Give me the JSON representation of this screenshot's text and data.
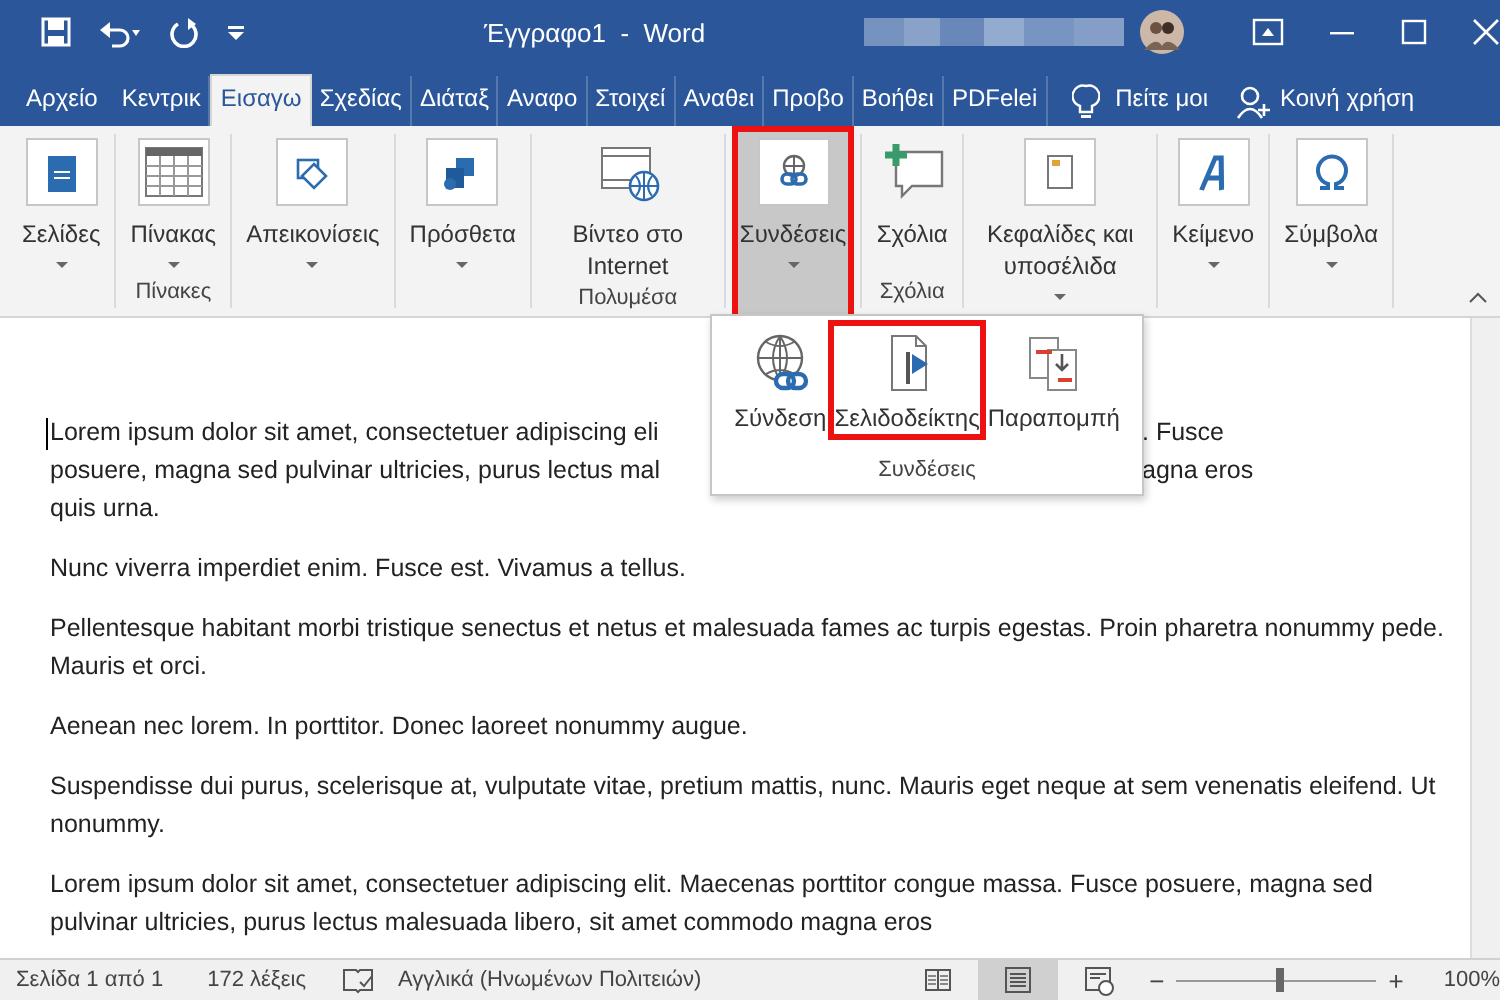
{
  "window": {
    "title": "Έγγραφο1  -  Word"
  },
  "tabs": [
    {
      "label": "Αρχείο",
      "selected": false
    },
    {
      "label": "Κεντρικ",
      "selected": false
    },
    {
      "label": "Εισαγω",
      "selected": true
    },
    {
      "label": "Σχεδίας",
      "selected": false
    },
    {
      "label": "Διάταξ",
      "selected": false
    },
    {
      "label": "Αναφο",
      "selected": false
    },
    {
      "label": "Στοιχεί",
      "selected": false
    },
    {
      "label": "Αναθει",
      "selected": false
    },
    {
      "label": "Προβο",
      "selected": false
    },
    {
      "label": "Βοήθει",
      "selected": false
    },
    {
      "label": "PDFelei",
      "selected": false
    }
  ],
  "tell_me": "Πείτε μοι",
  "share": "Κοινή χρήση",
  "ribbon": [
    {
      "buttons": [
        {
          "label": "Σελίδες",
          "kind": "page",
          "dropdown": true,
          "selected": false,
          "highlighted": false
        }
      ]
    },
    {
      "label": "Πίνακες",
      "buttons": [
        {
          "label": "Πίνακας",
          "kind": "table",
          "dropdown": true,
          "selected": false,
          "highlighted": false
        }
      ]
    },
    {
      "buttons": [
        {
          "label": "Απεικονίσεις",
          "kind": "shapes",
          "dropdown": true,
          "selected": false,
          "highlighted": false
        }
      ]
    },
    {
      "buttons": [
        {
          "label": "Πρόσθετα",
          "kind": "addin",
          "dropdown": true,
          "selected": false,
          "highlighted": false
        }
      ]
    },
    {
      "label": "Πολυμέσα",
      "buttons": [
        {
          "label": "Βίντεο στο Internet",
          "kind": "video",
          "dropdown": false,
          "selected": false,
          "highlighted": false
        }
      ]
    },
    {
      "buttons": [
        {
          "label": "Συνδέσεις",
          "kind": "link",
          "dropdown": true,
          "selected": true,
          "highlighted": true
        }
      ]
    },
    {
      "label": "Σχόλια",
      "buttons": [
        {
          "label": "Σχόλια",
          "kind": "comment",
          "dropdown": false,
          "selected": false,
          "highlighted": false
        }
      ]
    },
    {
      "buttons": [
        {
          "label": "Κεφαλίδες και υποσέλιδα",
          "kind": "header",
          "dropdown": true,
          "selected": false,
          "highlighted": false
        }
      ]
    },
    {
      "buttons": [
        {
          "label": "Κείμενο",
          "kind": "text",
          "dropdown": true,
          "selected": false,
          "highlighted": false
        }
      ]
    },
    {
      "buttons": [
        {
          "label": "Σύμβολα",
          "kind": "symbol",
          "dropdown": true,
          "selected": false,
          "highlighted": false
        }
      ]
    }
  ],
  "popup": {
    "label": "Συνδέσεις",
    "items": [
      {
        "label": "Σύνδεση",
        "kind": "globe",
        "highlighted": false
      },
      {
        "label": "Σελιδοδείκτης",
        "kind": "bookmark",
        "highlighted": true
      },
      {
        "label": "Παραπομπή",
        "kind": "crossref",
        "highlighted": false
      }
    ]
  },
  "document": {
    "paragraphs": [
      {
        "lines": [
          {
            "left": "Lorem ipsum dolor sit amet, consectetuer adipiscing eli",
            "right": ". Fusce"
          },
          {
            "left": "posuere, magna sed pulvinar ultricies, purus lectus mal",
            "right": "agna eros"
          },
          {
            "left": "quis urna."
          }
        ]
      },
      {
        "text": "Nunc viverra imperdiet enim. Fusce est. Vivamus a tellus."
      },
      {
        "text": "Pellentesque habitant morbi tristique senectus et netus et malesuada fames ac turpis egestas. Proin pharetra nonummy pede. Mauris et orci."
      },
      {
        "text": "Aenean nec lorem. In porttitor. Donec laoreet nonummy augue."
      },
      {
        "text": "Suspendisse dui purus, scelerisque at, vulputate vitae, pretium mattis, nunc. Mauris eget neque at sem venenatis eleifend. Ut nonummy."
      },
      {
        "text": "Lorem ipsum dolor sit amet, consectetuer adipiscing elit. Maecenas porttitor congue massa. Fusce posuere, magna sed pulvinar ultricies, purus lectus malesuada libero, sit amet commodo magna eros"
      }
    ]
  },
  "status_bar": {
    "page": "Σελίδα 1 από 1",
    "words": "172 λέξεις",
    "language": "Αγγλικά (Ηνωμένων Πολιτειών)",
    "views": [
      {
        "kind": "read",
        "selected": false
      },
      {
        "kind": "print",
        "selected": true
      },
      {
        "kind": "web",
        "selected": false
      }
    ],
    "zoom_minus": "−",
    "zoom_plus": "+",
    "zoom": {
      "level": 0.5
    },
    "zoom_text": "100%"
  }
}
